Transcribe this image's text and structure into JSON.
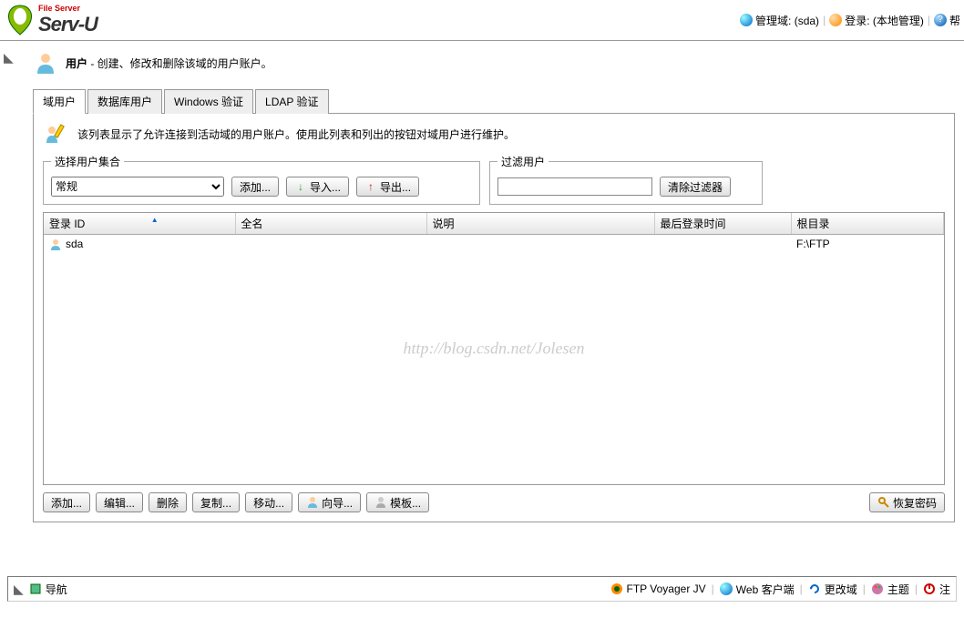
{
  "header": {
    "product_sub": "File Server",
    "product_main": "Serv-U",
    "domain_label": "管理域: (sda)",
    "login_label": "登录: (本地管理)",
    "help_label": "帮"
  },
  "page": {
    "title_prefix": "用户",
    "title_desc": " - 创建、修改和删除该域的用户账户。"
  },
  "tabs": [
    {
      "label": "域用户",
      "active": true
    },
    {
      "label": "数据库用户",
      "active": false
    },
    {
      "label": "Windows 验证",
      "active": false
    },
    {
      "label": "LDAP 验证",
      "active": false
    }
  ],
  "info_text": "该列表显示了允许连接到活动域的用户账户。使用此列表和列出的按钮对域用户进行维护。",
  "select_fieldset": {
    "legend": "选择用户集合",
    "selected": "常规",
    "add_btn": "添加...",
    "import_btn": "导入...",
    "export_btn": "导出..."
  },
  "filter_fieldset": {
    "legend": "过滤用户",
    "clear_btn": "清除过滤器",
    "value": ""
  },
  "table": {
    "columns": [
      "登录 ID",
      "全名",
      "说明",
      "最后登录时间",
      "根目录"
    ],
    "rows": [
      {
        "login": "sda",
        "fullname": "",
        "desc": "",
        "last": "",
        "root": "F:\\FTP"
      }
    ]
  },
  "watermark": "http://blog.csdn.net/Jolesen",
  "actions": {
    "add": "添加...",
    "edit": "编辑...",
    "delete": "删除",
    "copy": "复制...",
    "move": "移动...",
    "wizard": "向导...",
    "template": "模板...",
    "recover": "恢复密码"
  },
  "footer": {
    "nav": "导航",
    "voyager": "FTP Voyager JV",
    "web_client": "Web 客户端",
    "change_domain": "更改域",
    "theme": "主题",
    "logout": "注"
  }
}
